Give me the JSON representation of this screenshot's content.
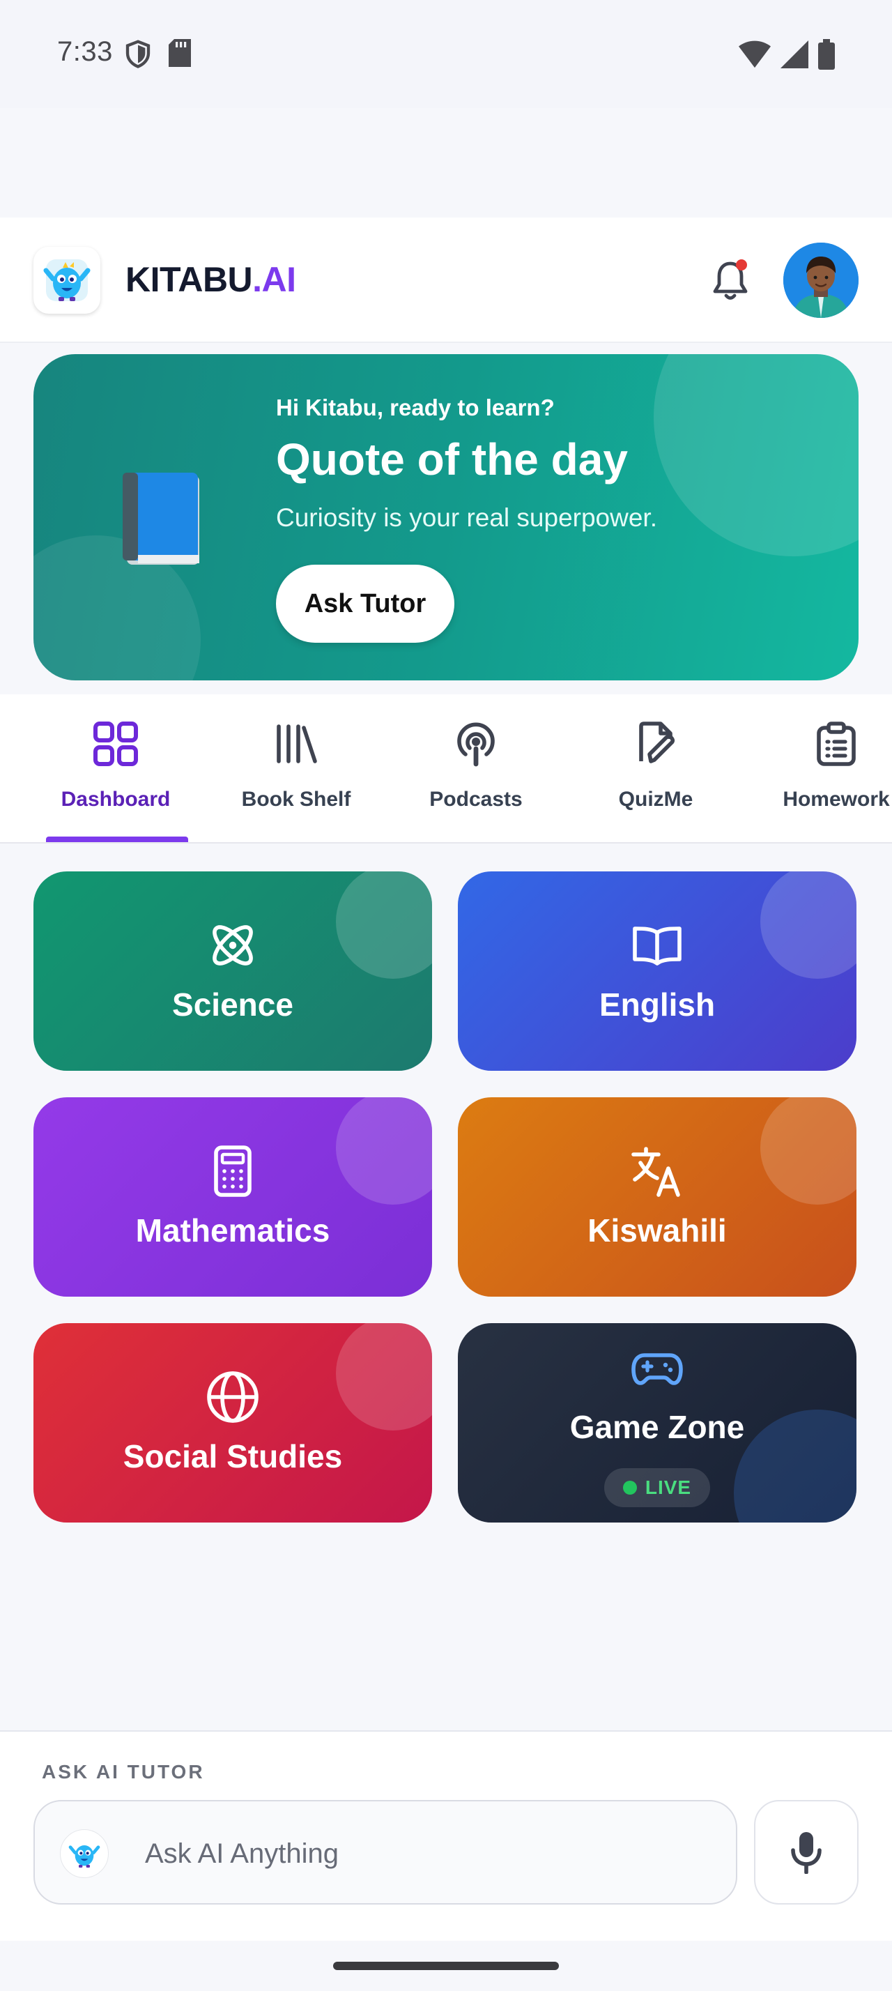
{
  "status_bar": {
    "time": "7:33",
    "left_icons": [
      "shield-icon",
      "sd-card-icon"
    ],
    "right_icons": [
      "wifi-icon",
      "cellular-signal-icon",
      "battery-icon"
    ]
  },
  "header": {
    "brand_primary": "KITABU",
    "brand_accent": ".AI",
    "accent_color": "#7c3aed",
    "notifications_icon": "bell-icon",
    "notification_dot_color": "#e53935"
  },
  "hero": {
    "greeting": "Hi Kitabu, ready to learn?",
    "title": "Quote of the day",
    "quote": "Curiosity is your real superpower.",
    "button_label": "Ask Tutor",
    "icon": "book-icon"
  },
  "tabs": [
    {
      "label": "Dashboard",
      "icon": "grid-icon",
      "active": true
    },
    {
      "label": "Book Shelf",
      "icon": "library-icon",
      "active": false
    },
    {
      "label": "Podcasts",
      "icon": "podcast-icon",
      "active": false
    },
    {
      "label": "QuizMe",
      "icon": "quiz-icon",
      "active": false
    },
    {
      "label": "Homework",
      "icon": "clipboard-icon",
      "active": false
    }
  ],
  "subjects": [
    {
      "title": "Science",
      "icon": "atom-icon",
      "color": "#119770"
    },
    {
      "title": "English",
      "icon": "open-book-icon",
      "color": "#3268e6"
    },
    {
      "title": "Mathematics",
      "icon": "calculator-icon",
      "color": "#943ae8"
    },
    {
      "title": "Kiswahili",
      "icon": "translate-icon",
      "color": "#dc7c12"
    },
    {
      "title": "Social Studies",
      "icon": "globe-icon",
      "color": "#df3038"
    },
    {
      "title": "Game Zone",
      "icon": "gamepad-icon",
      "color": "#283142",
      "badge": "LIVE"
    }
  ],
  "ask_panel": {
    "label": "ASK AI TUTOR",
    "placeholder": "Ask AI Anything",
    "mic_icon": "microphone-icon"
  }
}
